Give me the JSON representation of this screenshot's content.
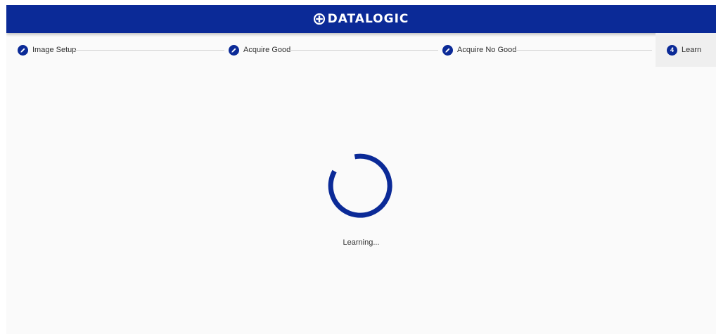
{
  "header": {
    "brand": "DATALOGIC"
  },
  "stepper": {
    "steps": [
      {
        "label": "Image Setup",
        "state": "edit",
        "icon": "pencil-icon"
      },
      {
        "label": "Acquire Good",
        "state": "edit",
        "icon": "pencil-icon"
      },
      {
        "label": "Acquire No Good",
        "state": "edit",
        "icon": "pencil-icon"
      },
      {
        "label": "Learn",
        "state": "active",
        "number": "4"
      }
    ]
  },
  "main": {
    "status_text": "Learning..."
  },
  "colors": {
    "brand_blue": "#0b2a97",
    "background": "#fafafa",
    "active_step_bg": "#efefef"
  }
}
